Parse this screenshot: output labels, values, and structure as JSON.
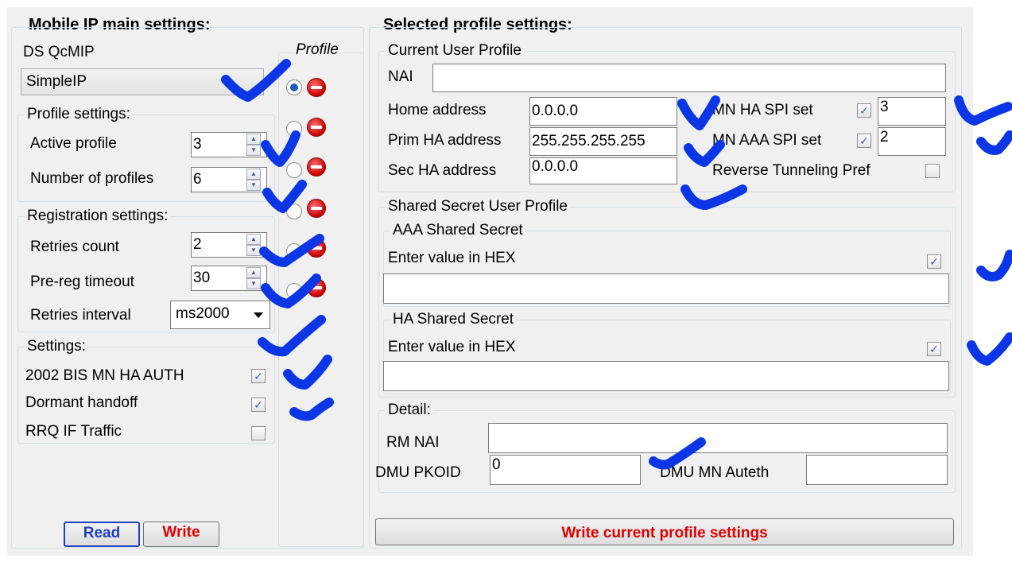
{
  "left_panel": {
    "title": "Mobile IP main settings:",
    "ds_group": {
      "legend": "DS QcMIP",
      "combo_value": "SimpleIP"
    },
    "profile_settings": {
      "legend": "Profile settings:",
      "active_profile_label": "Active profile",
      "active_profile_value": "3",
      "num_profiles_label": "Number of profiles",
      "num_profiles_value": "6"
    },
    "registration": {
      "legend": "Registration settings:",
      "retries_count_label": "Retries count",
      "retries_count_value": "2",
      "prereg_timeout_label": "Pre-reg timeout",
      "prereg_timeout_value": "30",
      "retries_interval_label": "Retries interval",
      "retries_interval_value": "ms2000"
    },
    "settings": {
      "legend": "Settings:",
      "items": [
        {
          "label": "2002 BIS MN HA AUTH",
          "checked": true
        },
        {
          "label": "Dormant handoff",
          "checked": true
        },
        {
          "label": "RRQ IF Traffic",
          "checked": false
        }
      ]
    },
    "read_button": "Read",
    "write_button": "Write"
  },
  "profile_column": {
    "legend": "Profile",
    "selected_index": 0,
    "count": 6
  },
  "right_panel": {
    "title": "Selected profile settings:",
    "current_user": {
      "legend": "Current User Profile",
      "nai_label": "NAI",
      "nai_value": "",
      "home_address_label": "Home address",
      "home_address_value": "0.0.0.0",
      "prim_ha_label": "Prim HA address",
      "prim_ha_value": "255.255.255.255",
      "sec_ha_label": "Sec HA address",
      "sec_ha_value": "0.0.0.0",
      "mn_ha_spi_label": "MN HA SPI set",
      "mn_ha_spi_checked": true,
      "mn_ha_spi_value": "3",
      "mn_aaa_spi_label": "MN AAA SPI set",
      "mn_aaa_spi_checked": true,
      "mn_aaa_spi_value": "2",
      "reverse_tunneling_label": "Reverse Tunneling Pref",
      "reverse_tunneling_checked": false
    },
    "shared_secret": {
      "legend": "Shared Secret User Profile",
      "aaa": {
        "legend": "AAA Shared Secret",
        "hex_label": "Enter value in HEX",
        "hex_checked": true,
        "value": ""
      },
      "ha": {
        "legend": "HA Shared Secret",
        "hex_label": "Enter value in HEX",
        "hex_checked": true,
        "value": ""
      }
    },
    "detail": {
      "legend": "Detail:",
      "rm_nai_label": "RM NAI",
      "rm_nai_value": "",
      "dmu_pkoid_label": "DMU PKOID",
      "dmu_pkoid_value": "0",
      "dmu_mn_auth_label": "DMU MN Auteth",
      "dmu_mn_auth_value": ""
    },
    "write_current_button": "Write current profile settings"
  },
  "colors": {
    "window_bg": "#f0f0f0",
    "accent_blue": "#1e5db5",
    "write_red": "#e00000",
    "read_blue": "#1f3fbf",
    "annotation_blue": "#0b36e6"
  }
}
